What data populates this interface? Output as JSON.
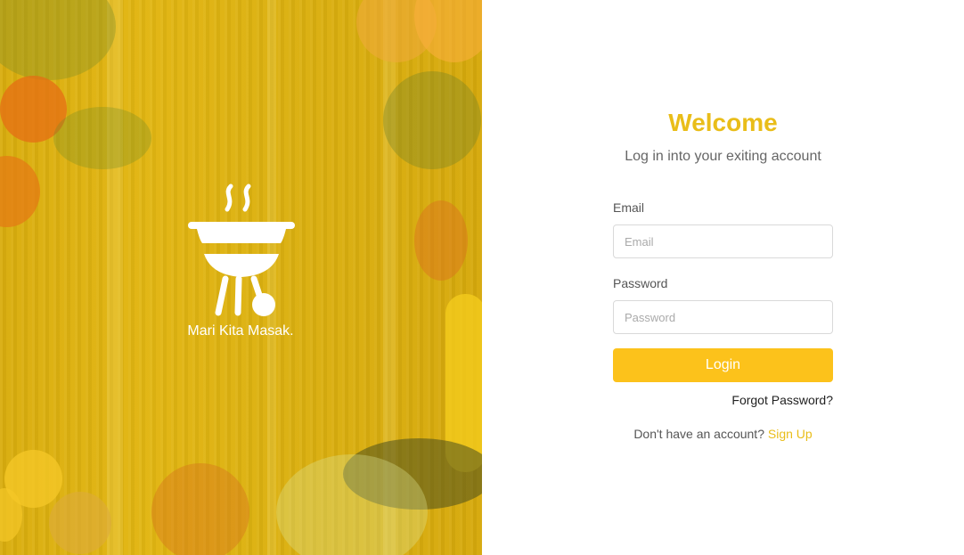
{
  "brand": {
    "tagline": "Mari Kita Masak.",
    "logo_icon": "grill-icon"
  },
  "login": {
    "title": "Welcome",
    "subtitle": "Log in into your exiting account",
    "email_label": "Email",
    "email_placeholder": "Email",
    "email_value": "",
    "password_label": "Password",
    "password_placeholder": "Password",
    "password_value": "",
    "login_label": "Login",
    "forgot_label": "Forgot Password?",
    "signup_prompt": "Don't have an account?",
    "signup_label": "Sign Up"
  },
  "colors": {
    "accent": "#fcc21b",
    "title": "#e9bd19",
    "overlay": "#e2b612"
  }
}
